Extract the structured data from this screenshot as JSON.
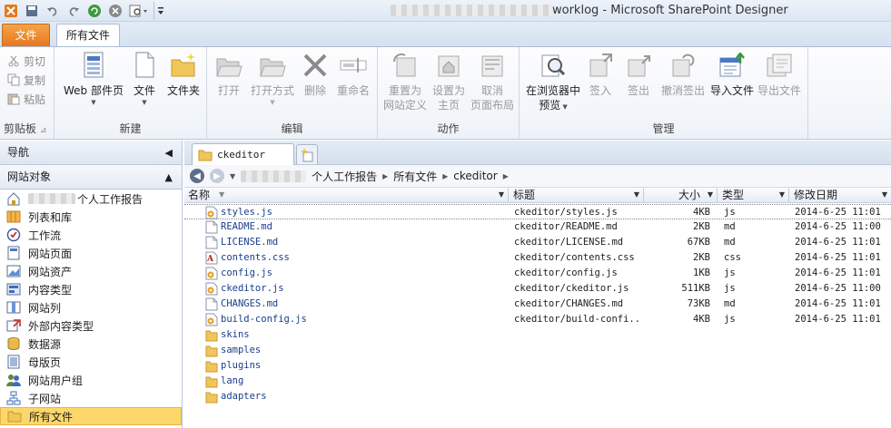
{
  "window": {
    "title_suffix": "worklog - Microsoft SharePoint Designer"
  },
  "ribbon_tabs": {
    "file": "文件",
    "all_files": "所有文件"
  },
  "clipboard": {
    "cut": "剪切",
    "copy": "复制",
    "paste": "粘贴",
    "group": "剪贴板"
  },
  "new_group": {
    "web_part_page": "Web 部件页",
    "file": "文件",
    "folder": "文件夹",
    "group": "新建"
  },
  "edit_group": {
    "open": "打开",
    "open_with": "打开方式",
    "delete": "删除",
    "rename": "重命名",
    "group": "编辑"
  },
  "action_group": {
    "reset_site_def_1": "重置为",
    "reset_site_def_2": "网站定义",
    "set_home_1": "设置为",
    "set_home_2": "主页",
    "detach_layout_1": "取消",
    "detach_layout_2": "页面布局",
    "group": "动作"
  },
  "manage_group": {
    "preview_1": "在浏览器中",
    "preview_2": "预览",
    "check_in": "签入",
    "check_out": "签出",
    "undo_checkout": "撤消签出",
    "import": "导入文件",
    "export": "导出文件",
    "group": "管理"
  },
  "nav": {
    "header": "导航",
    "section": "网站对象",
    "items": [
      {
        "label": "个人工作报告",
        "icon": "home-icon"
      },
      {
        "label": "列表和库",
        "icon": "list-icon"
      },
      {
        "label": "工作流",
        "icon": "workflow-icon"
      },
      {
        "label": "网站页面",
        "icon": "page-icon"
      },
      {
        "label": "网站资产",
        "icon": "asset-icon"
      },
      {
        "label": "内容类型",
        "icon": "content-type-icon"
      },
      {
        "label": "网站列",
        "icon": "column-icon"
      },
      {
        "label": "外部内容类型",
        "icon": "external-content-icon"
      },
      {
        "label": "数据源",
        "icon": "datasource-icon"
      },
      {
        "label": "母版页",
        "icon": "master-page-icon"
      },
      {
        "label": "网站用户组",
        "icon": "group-icon"
      },
      {
        "label": "子网站",
        "icon": "subsite-icon"
      },
      {
        "label": "所有文件",
        "icon": "folder-icon",
        "selected": true
      }
    ]
  },
  "doc_tab": {
    "label": "ckeditor"
  },
  "breadcrumb": {
    "site": "个人工作报告",
    "all_files": "所有文件",
    "folder": "ckeditor",
    "sep": "▸"
  },
  "columns": {
    "name": "名称",
    "title": "标题",
    "size": "大小",
    "type": "类型",
    "modified": "修改日期"
  },
  "files": [
    {
      "name": "styles.js",
      "title": "ckeditor/styles.js",
      "size": "4KB",
      "type": "js",
      "date": "2014-6-25 11:01",
      "icon": "js-file-icon"
    },
    {
      "name": "README.md",
      "title": "ckeditor/README.md",
      "size": "2KB",
      "type": "md",
      "date": "2014-6-25 11:00",
      "icon": "generic-file-icon"
    },
    {
      "name": "LICENSE.md",
      "title": "ckeditor/LICENSE.md",
      "size": "67KB",
      "type": "md",
      "date": "2014-6-25 11:01",
      "icon": "generic-file-icon"
    },
    {
      "name": "contents.css",
      "title": "ckeditor/contents.css",
      "size": "2KB",
      "type": "css",
      "date": "2014-6-25 11:01",
      "icon": "css-file-icon"
    },
    {
      "name": "config.js",
      "title": "ckeditor/config.js",
      "size": "1KB",
      "type": "js",
      "date": "2014-6-25 11:01",
      "icon": "js-file-icon"
    },
    {
      "name": "ckeditor.js",
      "title": "ckeditor/ckeditor.js",
      "size": "511KB",
      "type": "js",
      "date": "2014-6-25 11:00",
      "icon": "js-file-icon"
    },
    {
      "name": "CHANGES.md",
      "title": "ckeditor/CHANGES.md",
      "size": "73KB",
      "type": "md",
      "date": "2014-6-25 11:01",
      "icon": "generic-file-icon"
    },
    {
      "name": "build-config.js",
      "title": "ckeditor/build-confi...",
      "size": "4KB",
      "type": "js",
      "date": "2014-6-25 11:01",
      "icon": "js-file-icon"
    }
  ],
  "folders": [
    "skins",
    "samples",
    "plugins",
    "lang",
    "adapters"
  ],
  "colors": {
    "file_tab": "#e5781f",
    "selection": "#fcd76b",
    "link": "#1a3e8c"
  }
}
